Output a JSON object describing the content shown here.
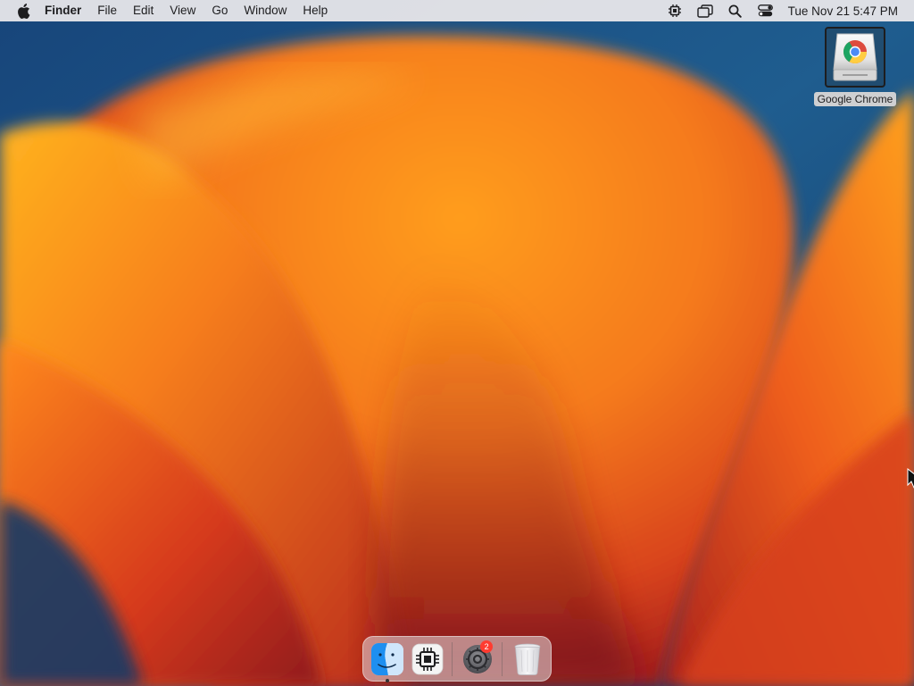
{
  "menubar": {
    "apple_icon": "apple-logo-icon",
    "app_name": "Finder",
    "menus": [
      "File",
      "Edit",
      "View",
      "Go",
      "Window",
      "Help"
    ],
    "status_icons": [
      "cpu-chip-icon",
      "screen-mirroring-icon",
      "spotlight-search-icon",
      "control-center-icon"
    ],
    "clock": "Tue Nov 21  5:47 PM"
  },
  "desktop": {
    "icons": [
      {
        "label": "Google Chrome",
        "icon": "google-chrome-disk-icon",
        "selected": true
      }
    ]
  },
  "dock": {
    "items": [
      {
        "name": "Finder",
        "icon": "finder-icon",
        "running": true
      },
      {
        "name": "Chip app",
        "icon": "cpu-chip-icon",
        "running": false
      },
      {
        "name": "System Settings",
        "icon": "system-settings-icon",
        "running": false,
        "badge": "2"
      },
      {
        "name": "Trash",
        "icon": "trash-icon",
        "running": false
      }
    ]
  },
  "colors": {
    "wallpaper_blue": "#1b4f80",
    "wallpaper_orange": "#f7941d",
    "wallpaper_red": "#c9301d",
    "badge_red": "#ff3b30",
    "finder_blue": "#1e8ff0"
  }
}
